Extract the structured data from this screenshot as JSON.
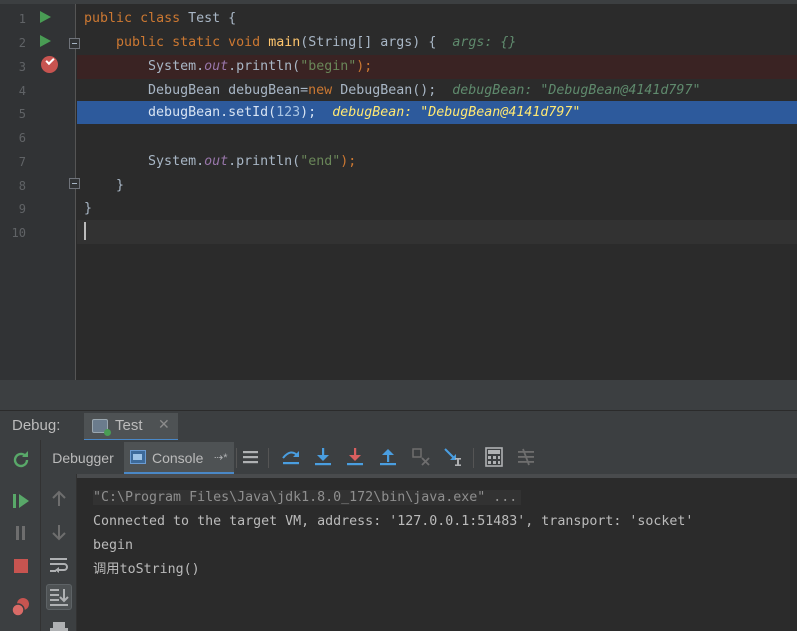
{
  "editor": {
    "line_numbers": [
      "1",
      "2",
      "3",
      "4",
      "5",
      "6",
      "7",
      "8",
      "9",
      "10"
    ],
    "lines": {
      "l1": {
        "kw1": "public",
        "kw2": "class",
        "rest": " Test {"
      },
      "l2": {
        "kw1": "public",
        "kw2": "static",
        "kw3": "void",
        "fn": "main",
        "rest": "(String[] args) {",
        "hint": "args: {}"
      },
      "l3": {
        "a": "System.",
        "fld": "out",
        "b": ".println(",
        "str": "\"begin\"",
        "c": ");"
      },
      "l4": {
        "a": "DebugBean debugBean=",
        "kw": "new",
        "b": " DebugBean();",
        "hint": "debugBean: \"DebugBean@4141d797\""
      },
      "l5": {
        "a": "debugBean.setId(",
        "num": "123",
        "b": ");",
        "hint": "debugBean: \"DebugBean@4141d797\""
      },
      "l7": {
        "a": "System.",
        "fld": "out",
        "b": ".println(",
        "str": "\"end\"",
        "c": ");"
      },
      "l8": "}",
      "l9": "}"
    },
    "colors": {
      "background": "#2b2b2b",
      "gutter": "#313335",
      "breakpoint_line": "#3a2323",
      "execution_line": "#2d5a9c",
      "current_line": "#323232"
    }
  },
  "debug": {
    "title": "Debug:",
    "session_tab": "Test",
    "close_glyph": "✕",
    "tabs": {
      "debugger": "Debugger",
      "console": "Console",
      "pin": "⇢*"
    },
    "toolbar_icons": [
      "show-execution-point-icon",
      "step-over-icon",
      "step-into-icon",
      "force-step-into-icon",
      "step-out-icon",
      "drop-frame-icon",
      "run-to-cursor-icon",
      "evaluate-expression-icon",
      "trace-icon"
    ],
    "left_actions": [
      "rerun-icon",
      "resume-icon",
      "pause-icon",
      "stop-icon",
      "view-breakpoints-icon"
    ],
    "console_actions": [
      "up-arrow-icon",
      "down-arrow-icon",
      "soft-wrap-icon",
      "scroll-to-end-icon",
      "print-icon"
    ]
  },
  "console": {
    "command": "\"C:\\Program Files\\Java\\jdk1.8.0_172\\bin\\java.exe\" ...",
    "connected": "Connected to the target VM, address: '127.0.0.1:51483', transport: 'socket'",
    "line3": "begin",
    "line4": "调用toString()"
  }
}
